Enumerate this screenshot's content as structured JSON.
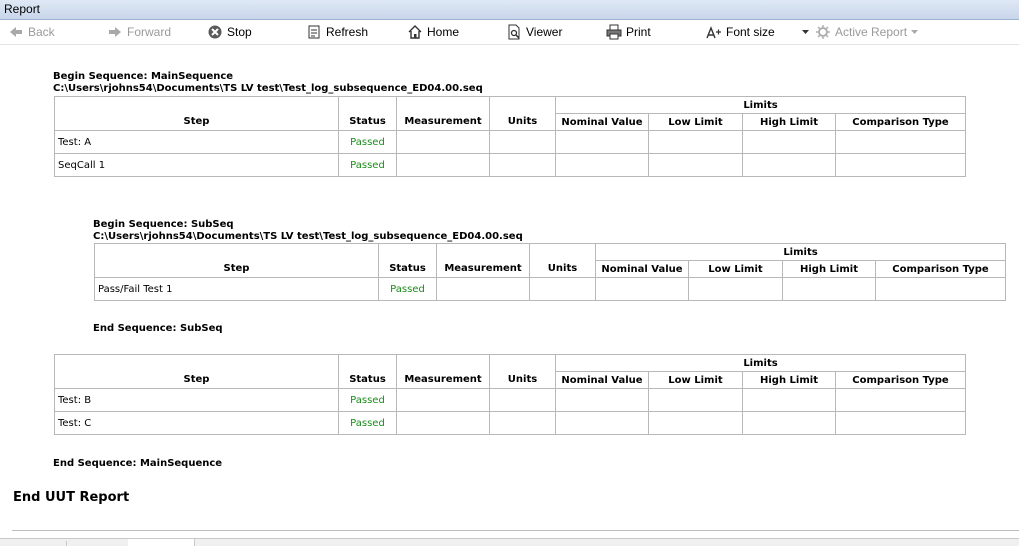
{
  "window": {
    "title": "Report"
  },
  "toolbar": {
    "back": "Back",
    "forward": "Forward",
    "stop": "Stop",
    "refresh": "Refresh",
    "home": "Home",
    "viewer": "Viewer",
    "print": "Print",
    "font_size": "Font size",
    "active_report": "Active Report"
  },
  "columns": {
    "step": "Step",
    "status": "Status",
    "measurement": "Measurement",
    "units": "Units",
    "limits": "Limits",
    "nominal": "Nominal Value",
    "low": "Low Limit",
    "high": "High Limit",
    "comparison": "Comparison Type"
  },
  "main_sequence": {
    "begin": "Begin Sequence: MainSequence",
    "path": "C:\\Users\\rjohns54\\Documents\\TS LV test\\Test_log_subsequence_ED04.00.seq",
    "rows": [
      {
        "step": "Test: A",
        "status": "Passed"
      },
      {
        "step": "SeqCall 1",
        "status": "Passed"
      }
    ],
    "rows2": [
      {
        "step": "Test: B",
        "status": "Passed"
      },
      {
        "step": "Test: C",
        "status": "Passed"
      }
    ],
    "end": "End Sequence: MainSequence"
  },
  "sub_sequence": {
    "begin": "Begin Sequence: SubSeq",
    "path": "C:\\Users\\rjohns54\\Documents\\TS LV test\\Test_log_subsequence_ED04.00.seq",
    "rows": [
      {
        "step": "Pass/Fail Test 1",
        "status": "Passed"
      }
    ],
    "end": "End Sequence: SubSeq"
  },
  "end_report": "End UUT Report",
  "colors": {
    "passed": "#1a8c1a",
    "titlebar": "#c8d6ea",
    "border": "#b8b8b8"
  },
  "icons": {
    "back": "left-arrow-icon",
    "forward": "right-arrow-icon",
    "stop": "stop-icon",
    "refresh": "refresh-icon",
    "home": "home-icon",
    "viewer": "viewer-icon",
    "print": "printer-icon",
    "font_size": "font-size-icon",
    "active_report": "active-report-icon"
  }
}
